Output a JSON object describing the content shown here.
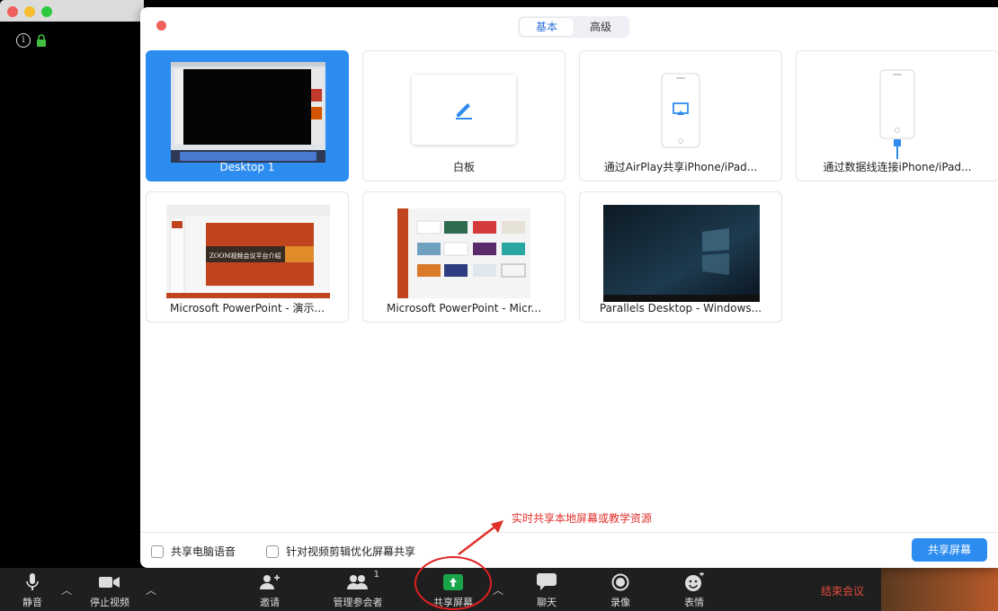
{
  "mode_tabs": [
    {
      "label": "基本",
      "active": true
    },
    {
      "label": "高级",
      "active": false
    }
  ],
  "share_sources": [
    {
      "label": "Desktop 1",
      "selected": true,
      "thumb_icon": "desktop-screen-thumbnail"
    },
    {
      "label": "白板",
      "selected": false,
      "thumb_icon": "pencil-icon"
    },
    {
      "label": "通过AirPlay共享iPhone/iPad...",
      "selected": false,
      "thumb_icon": "airplay-icon"
    },
    {
      "label": "通过数据线连接iPhone/iPad...",
      "selected": false,
      "thumb_icon": "cable-phone-icon"
    },
    {
      "label": "Microsoft PowerPoint - 演示...",
      "selected": false,
      "thumb_icon": "powerpoint-slide-thumbnail",
      "thumb_text": "ZOOM视频会议平台介绍"
    },
    {
      "label": "Microsoft PowerPoint - Micr...",
      "selected": false,
      "thumb_icon": "powerpoint-templates-thumbnail"
    },
    {
      "label": "Parallels Desktop - Windows...",
      "selected": false,
      "thumb_icon": "windows-desktop-thumbnail"
    }
  ],
  "options": {
    "share_audio": "共享电脑语音",
    "optimize_video": "针对视频剪辑优化屏幕共享"
  },
  "share_button": "共享屏幕",
  "annotation": "实时共享本地屏幕或教学资源",
  "toolbar": {
    "mute": "静音",
    "stop_video": "停止视频",
    "invite": "邀请",
    "participants": "管理参会者",
    "participants_count": "1",
    "share_screen": "共享屏幕",
    "chat": "聊天",
    "record": "录像",
    "reactions": "表情",
    "end_meeting": "结束会议"
  },
  "colors": {
    "accent": "#2d8cf0",
    "annotation_red": "#e0302c",
    "share_green": "#1aa44a",
    "end_red": "#e24a3c"
  }
}
